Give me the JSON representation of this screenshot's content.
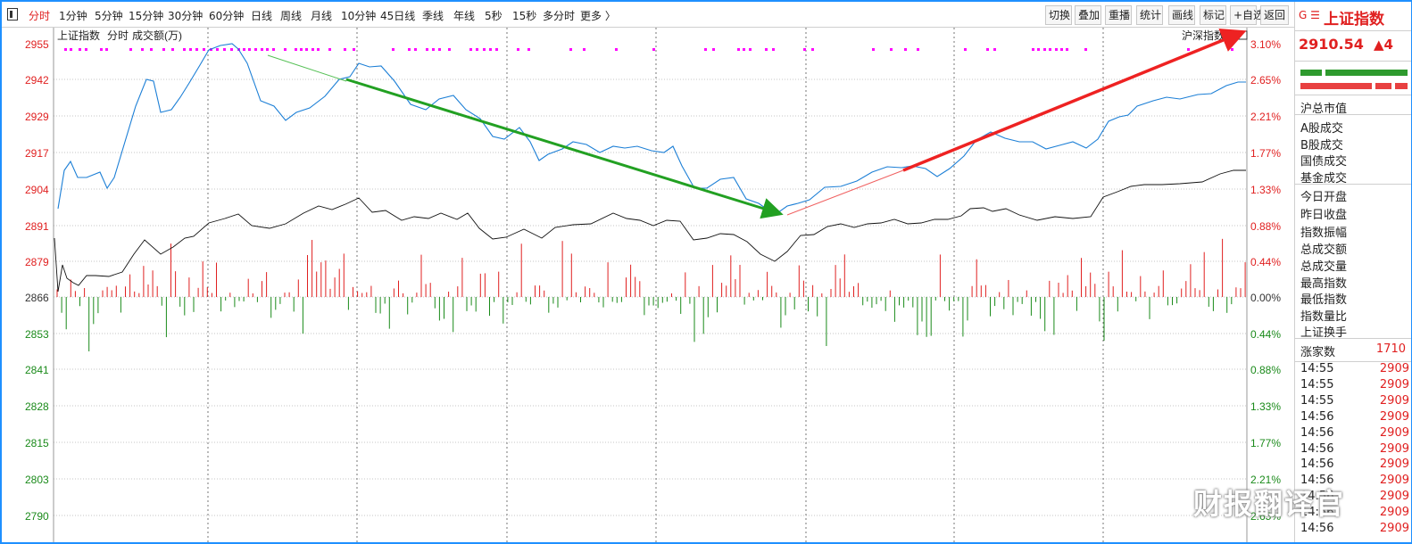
{
  "toolbar": {
    "periods": [
      "分时",
      "1分钟",
      "5分钟",
      "15分钟",
      "30分钟",
      "60分钟",
      "日线",
      "周线",
      "月线",
      "10分钟",
      "45日线",
      "季线",
      "年线",
      "5秒",
      "15秒",
      "多分时",
      "更多 〉"
    ],
    "active_period": "分时",
    "right_buttons": [
      "切换",
      "叠加",
      "重播",
      "统计",
      "画线",
      "标记",
      "+自选",
      "返回"
    ]
  },
  "chart": {
    "index_name": "上证指数",
    "mode": "分时",
    "volume_label": "成交额(万)",
    "overlay_label": "沪深指数",
    "left_ticks": [
      "2955",
      "2942",
      "2929",
      "2917",
      "2904",
      "2891",
      "2879",
      "2866",
      "2853",
      "2841",
      "2828",
      "2815",
      "2803",
      "2790"
    ],
    "right_ticks": [
      "3.10%",
      "2.65%",
      "2.21%",
      "1.77%",
      "1.33%",
      "0.88%",
      "0.44%",
      "0.00%",
      "0.44%",
      "0.88%",
      "1.33%",
      "1.77%",
      "2.21%",
      "2.65%"
    ],
    "colors": {
      "up": "#e02020",
      "down": "#1a8a1a",
      "index_line": "#1c7fd6",
      "avg_line": "#111111",
      "grid": "#8a8a8a",
      "marks": "#ff00ff"
    }
  },
  "sidebar": {
    "code_label": "G ☰",
    "title": "上证指数",
    "price": "2910.54",
    "change": "▲4",
    "stats_labels": [
      "沪总市值",
      "A股成交",
      "B股成交",
      "国债成交",
      "基金成交",
      "今日开盘",
      "昨日收盘",
      "指数振幅",
      "总成交额",
      "总成交量",
      "最高指数",
      "最低指数",
      "指数量比",
      "上证换手"
    ],
    "rise_label": "涨家数",
    "rise_value": "1710",
    "ticks": [
      {
        "time": "14:55",
        "value": "2909"
      },
      {
        "time": "14:55",
        "value": "2909"
      },
      {
        "time": "14:55",
        "value": "2909"
      },
      {
        "time": "14:56",
        "value": "2909"
      },
      {
        "time": "14:56",
        "value": "2909"
      },
      {
        "time": "14:56",
        "value": "2909"
      },
      {
        "time": "14:56",
        "value": "2909"
      },
      {
        "time": "14:56",
        "value": "2909"
      },
      {
        "time": "14:56",
        "value": "2909"
      },
      {
        "time": "14:56",
        "value": "2909"
      },
      {
        "time": "14:56",
        "value": "2909"
      }
    ]
  },
  "watermark": "财报翻译官"
}
